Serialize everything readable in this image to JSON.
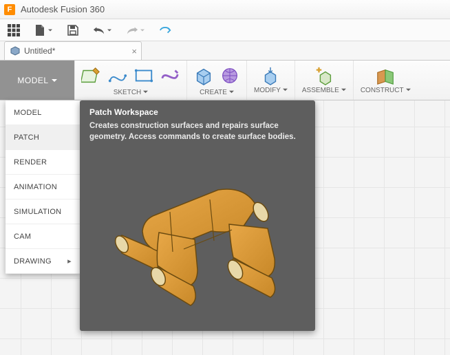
{
  "app": {
    "title": "Autodesk Fusion 360",
    "logo_letter": "F"
  },
  "tab": {
    "title": "Untitled*"
  },
  "workspace_button": {
    "label": "MODEL"
  },
  "ribbon": {
    "sketch": "SKETCH",
    "create": "CREATE",
    "modify": "MODIFY",
    "assemble": "ASSEMBLE",
    "construct": "CONSTRUCT"
  },
  "ws_menu": {
    "items": [
      {
        "label": "MODEL"
      },
      {
        "label": "PATCH"
      },
      {
        "label": "RENDER"
      },
      {
        "label": "ANIMATION"
      },
      {
        "label": "SIMULATION"
      },
      {
        "label": "CAM"
      },
      {
        "label": "DRAWING"
      }
    ]
  },
  "tooltip": {
    "title": "Patch Workspace",
    "body": "Creates construction surfaces and repairs surface geometry. Access commands to create surface bodies."
  }
}
